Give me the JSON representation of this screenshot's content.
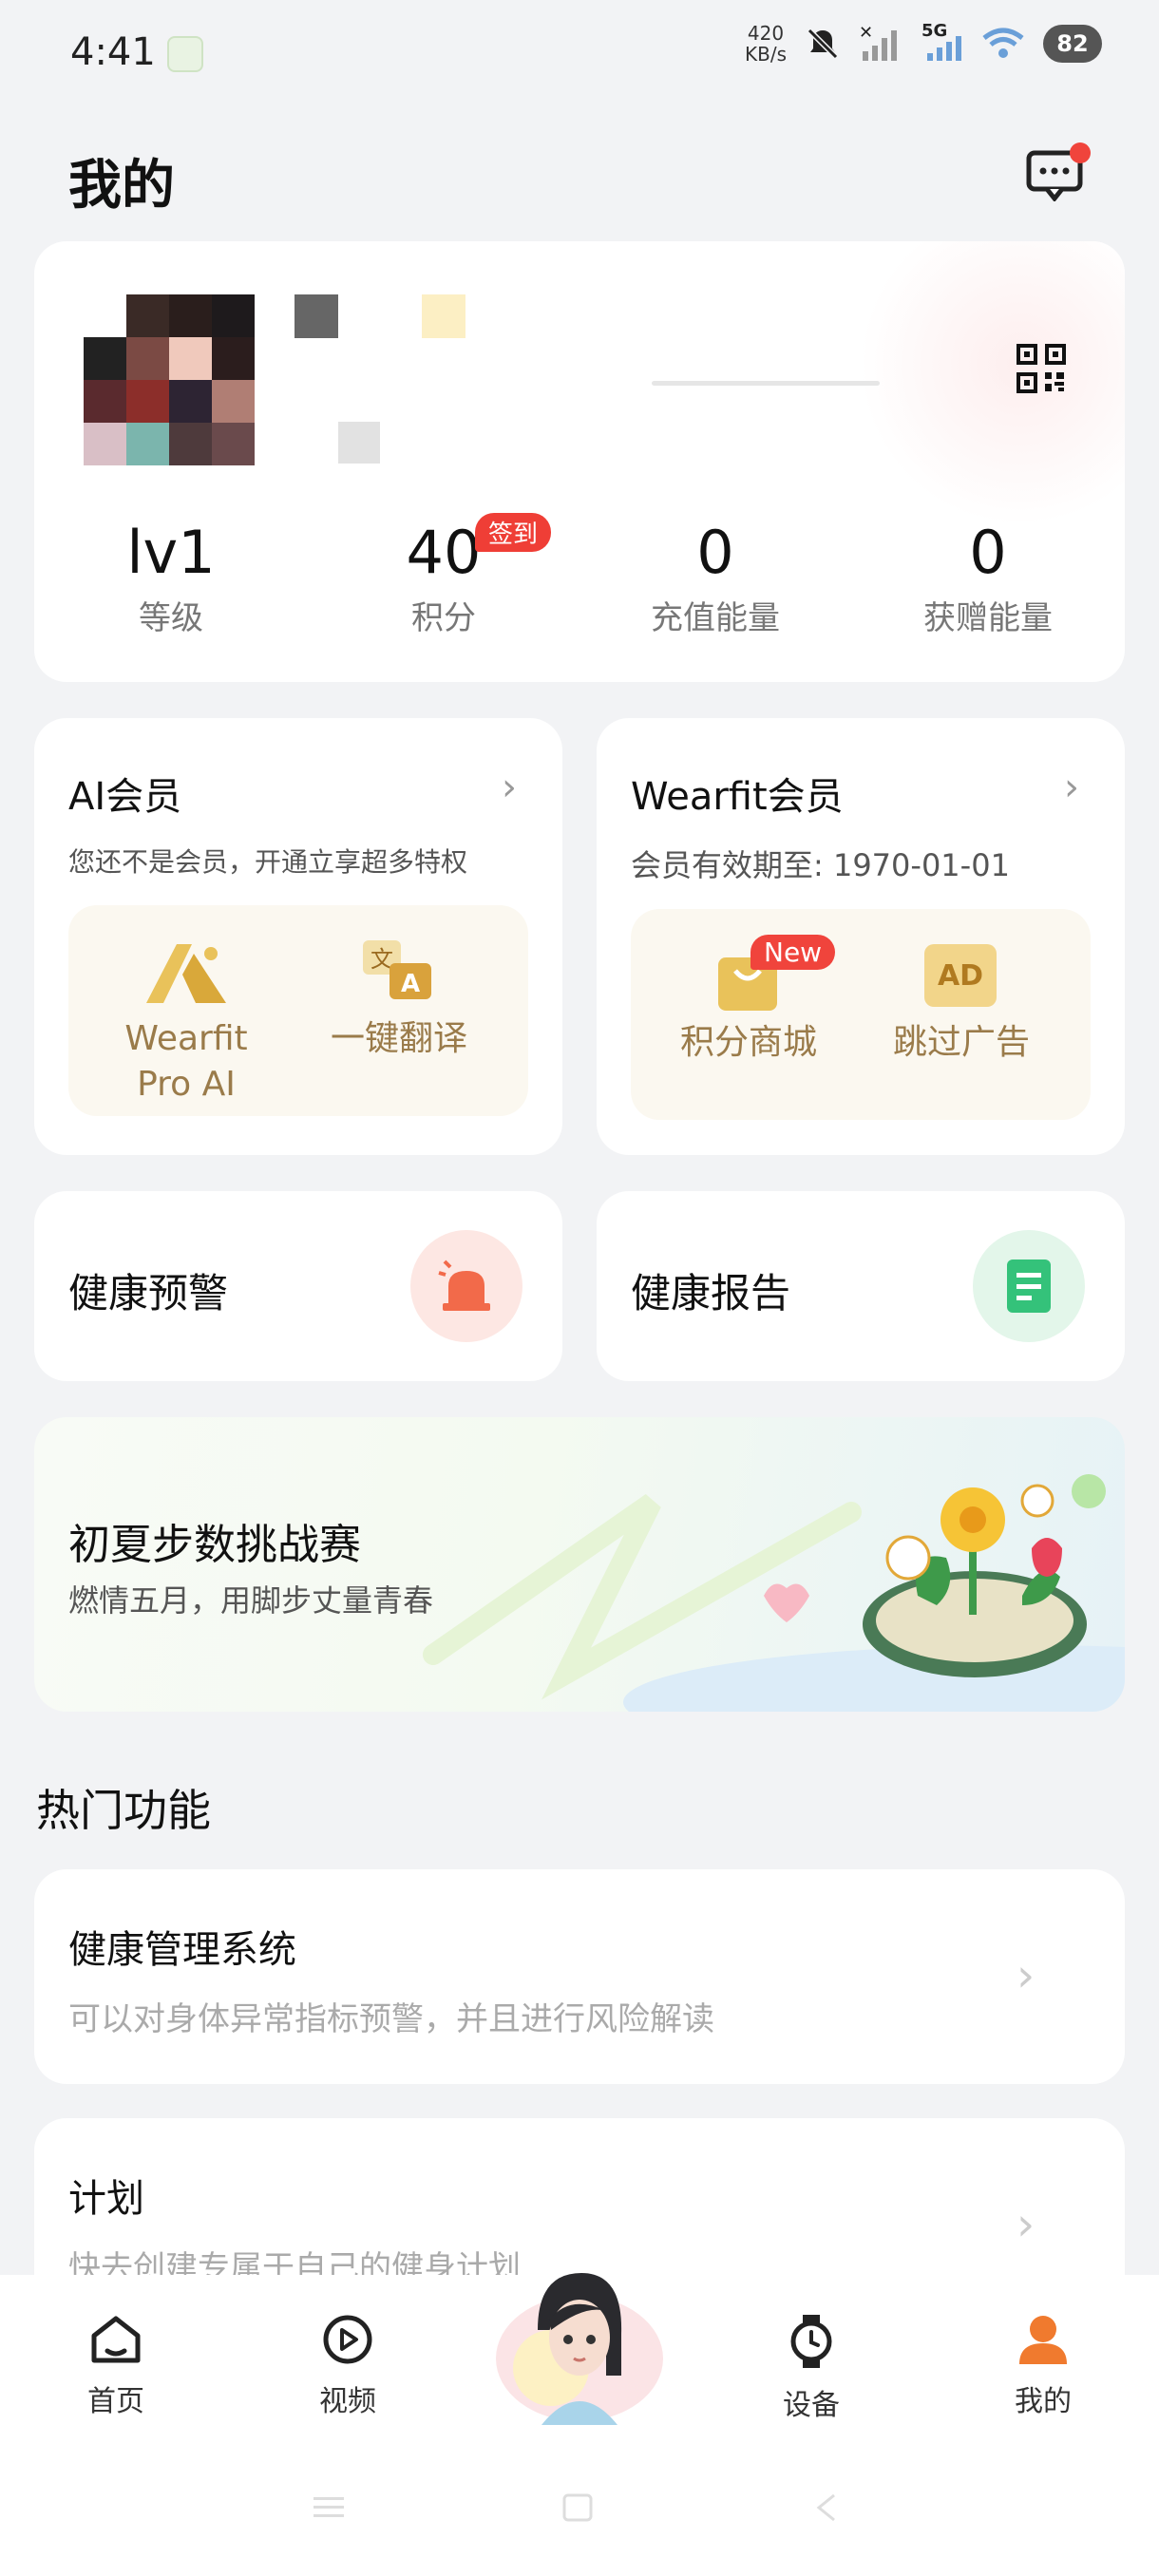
{
  "status_bar": {
    "time": "4:41",
    "net_speed_value": "420",
    "net_speed_unit": "KB/s",
    "network": "5G",
    "battery": "82"
  },
  "header": {
    "title": "我的"
  },
  "profile": {
    "stats": [
      {
        "value": "lv1",
        "label": "等级"
      },
      {
        "value": "40",
        "label": "积分"
      },
      {
        "value": "0",
        "label": "充值能量"
      },
      {
        "value": "0",
        "label": "获赠能量"
      }
    ],
    "signin_badge": "签到"
  },
  "ai_member": {
    "title": "AI会员",
    "subtitle": "您还不是会员，开通立享超多特权",
    "features": [
      {
        "label_line1": "Wearfit",
        "label_line2": "Pro AI",
        "icon": "wearfit-ai-icon"
      },
      {
        "label_line1": "一键翻译",
        "label_line2": "",
        "icon": "translate-icon"
      }
    ]
  },
  "wearfit_member": {
    "title": "Wearfit会员",
    "subtitle": "会员有效期至: 1970-01-01",
    "features": [
      {
        "label": "积分商城",
        "badge": "New",
        "icon": "shopping-bag-icon"
      },
      {
        "label": "跳过广告",
        "icon": "ad-icon",
        "icon_text": "AD"
      }
    ]
  },
  "health": {
    "warning": "健康预警",
    "report": "健康报告"
  },
  "banner": {
    "title": "初夏步数挑战赛",
    "subtitle": "燃情五月，用脚步丈量青春"
  },
  "hot_section": {
    "title": "热门功能",
    "items": [
      {
        "title": "健康管理系统",
        "subtitle": "可以对身体异常指标预警，并且进行风险解读"
      },
      {
        "title": "计划",
        "subtitle": "快去创建专属于自己的健身计划"
      }
    ]
  },
  "tabbar": {
    "items": [
      {
        "label": "首页",
        "icon": "home-icon"
      },
      {
        "label": "视频",
        "icon": "play-icon"
      },
      {
        "label": "设备",
        "icon": "watch-icon"
      },
      {
        "label": "我的",
        "icon": "person-icon"
      }
    ]
  },
  "colors": {
    "background": "#f2f3f5",
    "accent_red": "#ef3e36",
    "member_gold": "#9a7b4a",
    "person_orange": "#f07a2e"
  }
}
